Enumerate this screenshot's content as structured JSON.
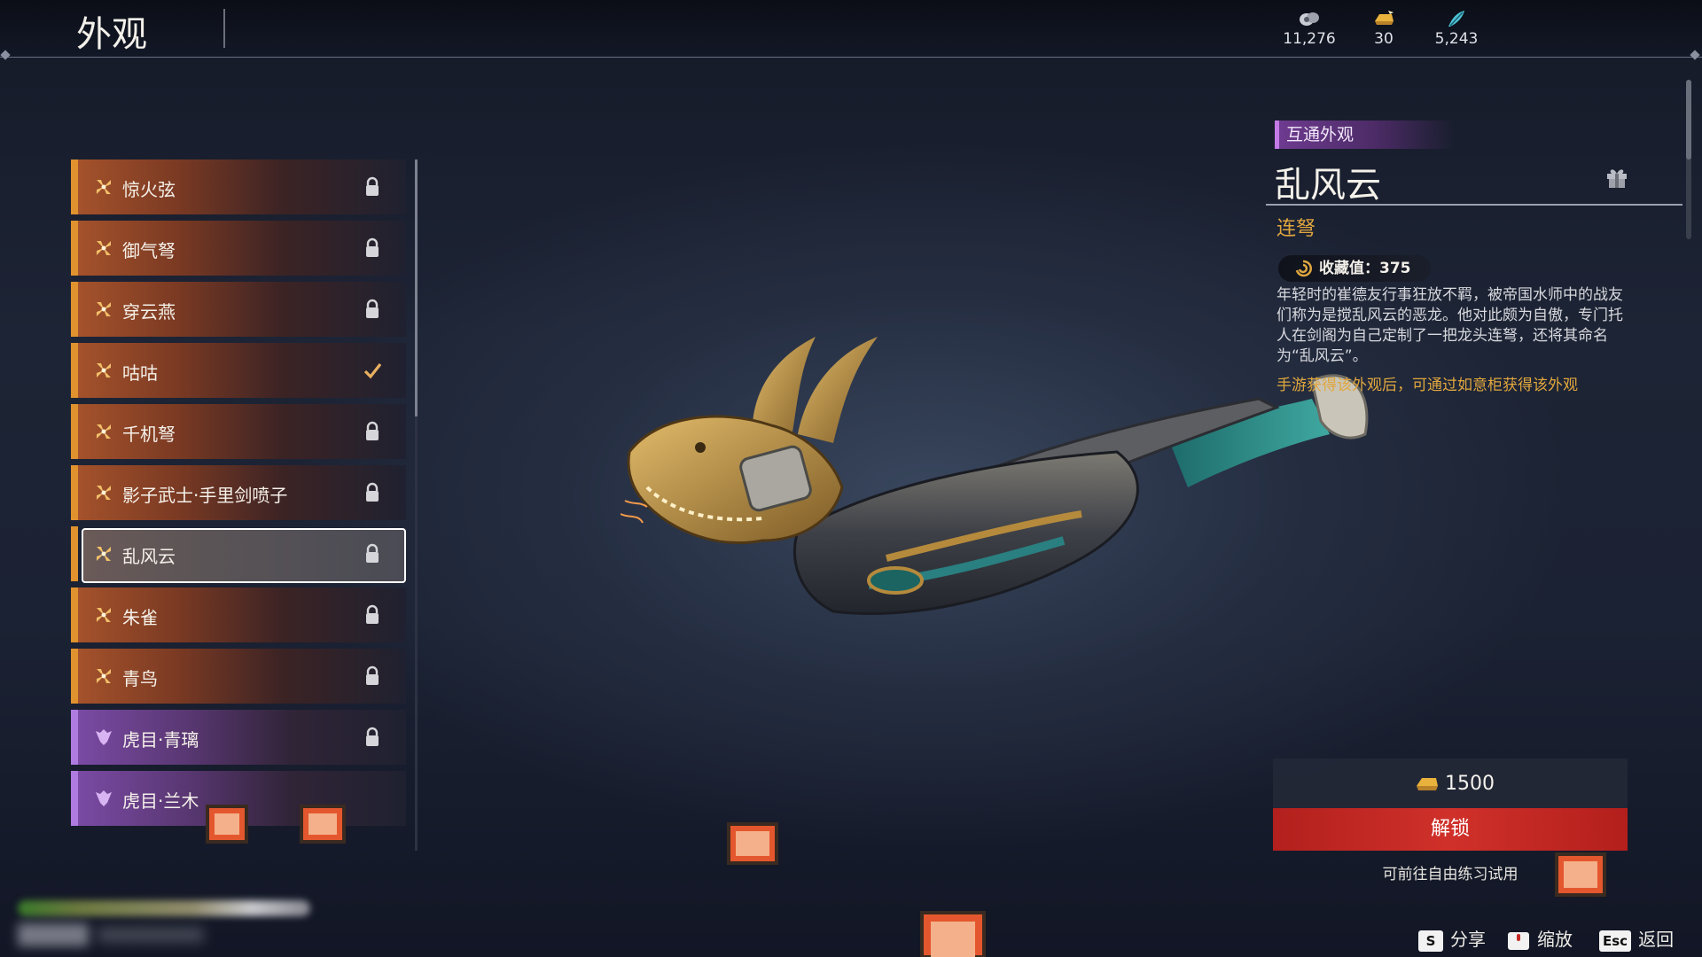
{
  "header": {
    "title": "外观",
    "currencies": [
      {
        "icon": "coin-pouch-icon",
        "value": "11,276"
      },
      {
        "icon": "gold-ingot-icon",
        "value": "30"
      },
      {
        "icon": "jade-feather-icon",
        "value": "5,243"
      }
    ]
  },
  "list": {
    "items": [
      {
        "label": "惊火弦",
        "tier": "orange",
        "icon": "flower-icon",
        "state": "locked"
      },
      {
        "label": "御气弩",
        "tier": "orange",
        "icon": "flower-icon",
        "state": "locked"
      },
      {
        "label": "穿云燕",
        "tier": "orange",
        "icon": "flower-icon",
        "state": "locked"
      },
      {
        "label": "咕咕",
        "tier": "orange",
        "icon": "flower-icon",
        "state": "equipped"
      },
      {
        "label": "千机弩",
        "tier": "orange",
        "icon": "flower-icon",
        "state": "locked"
      },
      {
        "label": "影子武士·手里剑喷子",
        "tier": "orange",
        "icon": "flower-icon",
        "state": "locked"
      },
      {
        "label": "乱风云",
        "tier": "orange",
        "icon": "flower-icon",
        "state": "locked",
        "selected": true
      },
      {
        "label": "朱雀",
        "tier": "orange",
        "icon": "flower-icon",
        "state": "locked"
      },
      {
        "label": "青鸟",
        "tier": "orange",
        "icon": "flower-icon",
        "state": "locked"
      },
      {
        "label": "虎目·青璃",
        "tier": "purple",
        "icon": "crown-icon",
        "state": "locked"
      },
      {
        "label": "虎目·兰木",
        "tier": "purple",
        "icon": "crown-icon",
        "state": "none"
      }
    ]
  },
  "detail": {
    "tag": "互通外观",
    "name": "乱风云",
    "type": "连弩",
    "collection": "收藏值：375",
    "description": "年轻时的崔德友行事狂放不羁，被帝国水师中的战友们称为是搅乱风云的恶龙。他对此颇为自傲，专门托人在剑阁为自己定制了一把龙头连弩，还将其命名为“乱风云”。",
    "hint": "手游获得该外观后，可通过如意柜获得该外观",
    "price": "1500",
    "unlock_label": "解锁",
    "trial_text": "可前往自由练习试用"
  },
  "footer": {
    "share_key": "S",
    "share_label": "分享",
    "zoom_label": "缩放",
    "back_key": "Esc",
    "back_label": "返回"
  },
  "colors": {
    "orange_tier": "#e0922f",
    "purple_tier": "#b07be0",
    "unlock_red": "#c62a25",
    "gold_text": "#e0a640"
  }
}
